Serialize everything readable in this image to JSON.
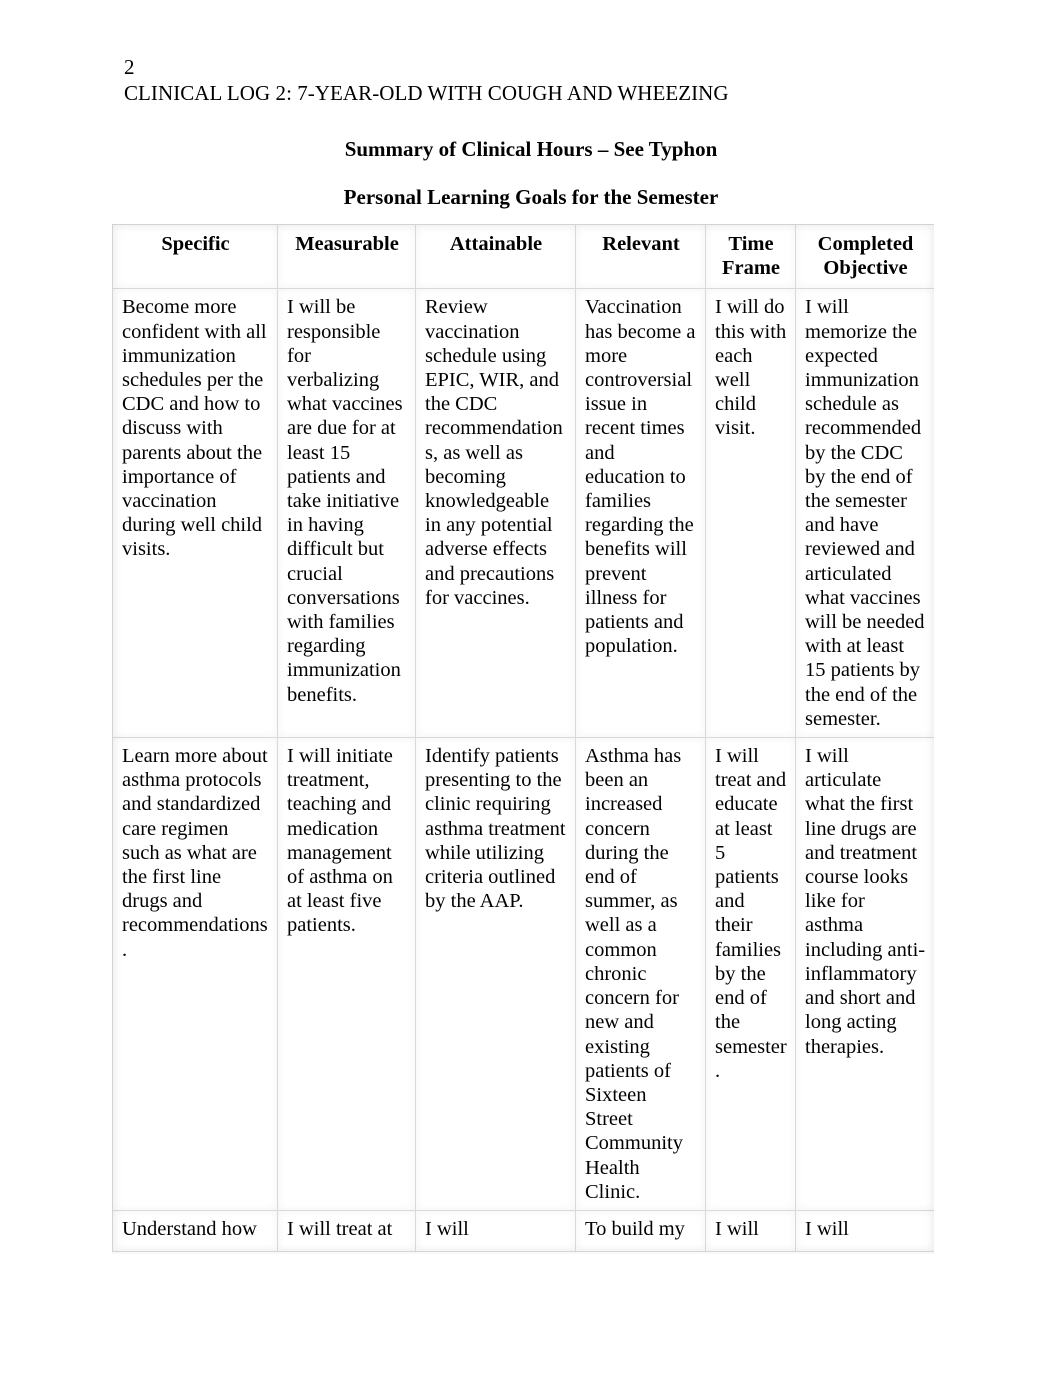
{
  "document": {
    "page_number": "2",
    "running_head": "CLINICAL LOG 2: 7-YEAR-OLD WITH COUGH AND WHEEZING",
    "heading_1": "Summary of Clinical Hours – See Typhon",
    "heading_2": "Personal Learning Goals for the Semester"
  },
  "table": {
    "headers": [
      "Specific",
      "Measurable",
      "Attainable",
      "Relevant",
      "Time Frame",
      "Completed Objective"
    ],
    "rows": [
      {
        "specific": "Become more confident with all immunization schedules per the CDC and how to discuss with parents about the importance of vaccination during well child visits.",
        "measurable": "I will be responsible for verbalizing what vaccines are due for at least 15 patients and take initiative in having difficult but crucial conversations with families regarding immunization benefits.",
        "attainable": "Review vaccination schedule using EPIC, WIR, and the CDC recommendations, as well as becoming knowledgeable in any potential adverse effects and precautions for vaccines.",
        "relevant": "Vaccination has become a more controversial issue in recent times and education to families regarding the benefits will prevent illness for patients and population.",
        "time_frame": "I will do this with each well child visit.",
        "completed_objective": "I will memorize the expected immunization schedule as recommended by the CDC by the end of the semester and have reviewed and articulated what vaccines will be needed with at least 15 patients by the end of the semester."
      },
      {
        "specific": "Learn more about asthma protocols and standardized care regimen such as what are the first line drugs and recommendations.",
        "measurable": "I will initiate treatment, teaching and medication management of asthma on at least five patients.",
        "attainable": "Identify patients presenting to the clinic requiring asthma treatment while utilizing criteria outlined by the AAP.",
        "relevant": "Asthma has been an increased concern during the end of summer, as well as a common chronic concern for new and existing patients of Sixteen Street Community Health Clinic.",
        "time_frame": "I will treat and educate at least 5 patients and their families by the end of the semester.",
        "completed_objective": "I will articulate what the first line drugs are and treatment course looks like for asthma including anti-inflammatory and short and long acting therapies."
      },
      {
        "specific": "Understand how",
        "measurable": "I will treat at",
        "attainable": "I will",
        "relevant": "To build my",
        "time_frame": "I will",
        "completed_objective": "I will"
      }
    ]
  }
}
